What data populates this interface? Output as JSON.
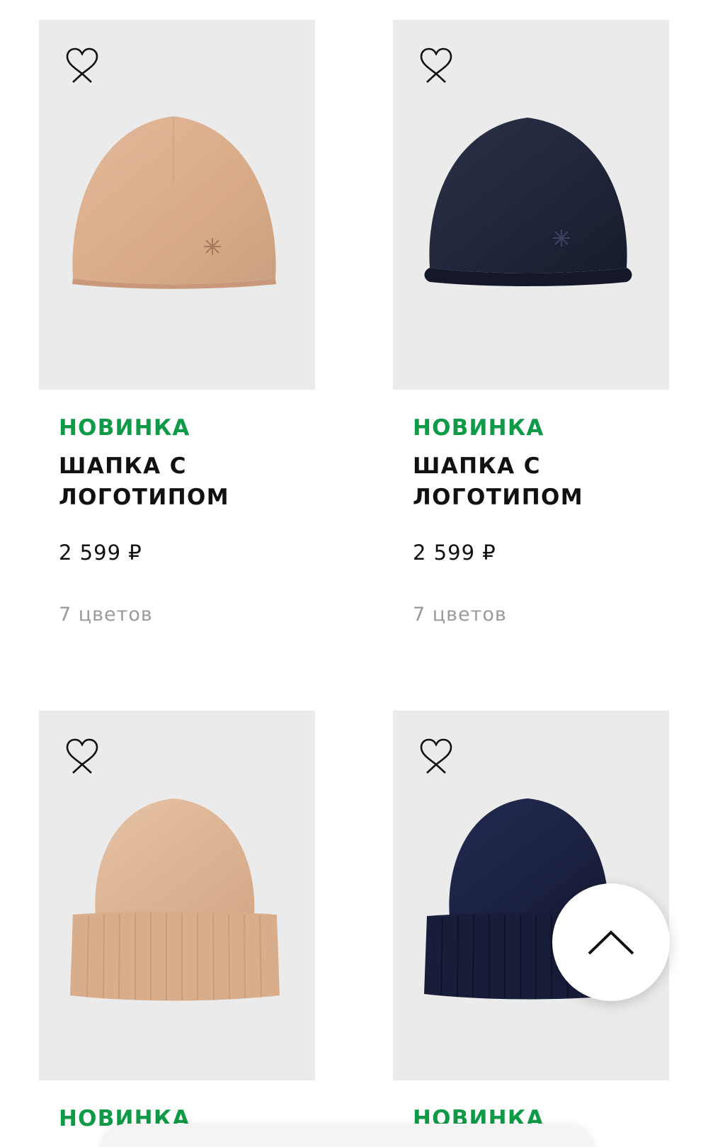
{
  "theme": {
    "accent": "#0f9a47",
    "text": "#111111",
    "muted": "#9a9a9a",
    "photo_bg": "#ebebeb"
  },
  "products": [
    {
      "badge": "НОВИНКА",
      "title_line1": "ШАПКА С",
      "title_line2": "ЛОГОТИПОМ",
      "price": "2 599 ₽",
      "colors": "7 цветов",
      "image": "beige-beanie-rolled-hem",
      "wishlist_icon": "heart-icon"
    },
    {
      "badge": "НОВИНКА",
      "title_line1": "ШАПКА С",
      "title_line2": "ЛОГОТИПОМ",
      "price": "2 599 ₽",
      "colors": "7 цветов",
      "image": "navy-beanie-rolled-hem",
      "wishlist_icon": "heart-icon"
    },
    {
      "badge": "НОВИНКА",
      "image": "beige-beanie-cuffed",
      "wishlist_icon": "heart-icon"
    },
    {
      "badge": "НОВИНКА",
      "image": "navy-beanie-cuffed",
      "wishlist_icon": "heart-icon"
    }
  ],
  "scroll_top": {
    "icon": "chevron-up-icon"
  }
}
